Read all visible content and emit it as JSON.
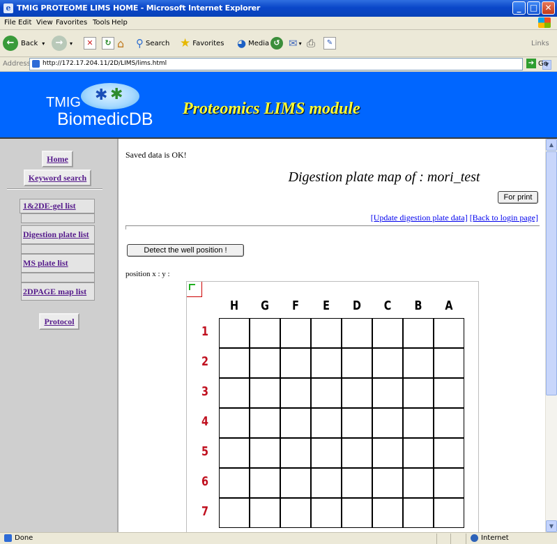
{
  "window": {
    "title": "TMIG PROTEOME LIMS HOME - Microsoft Internet Explorer"
  },
  "menu": [
    "File",
    "Edit",
    "View",
    "Favorites",
    "Tools",
    "Help"
  ],
  "toolbar": {
    "back": "Back",
    "search": "Search",
    "favorites": "Favorites",
    "media": "Media",
    "links": "Links"
  },
  "address": {
    "label": "Address",
    "url": "http://172.17.204.11/2D/LIMS/lims.html",
    "go": "Go"
  },
  "banner": {
    "logo_line1": "TMIG",
    "logo_line2": "BiomedicDB",
    "title": "Proteomics LIMS module"
  },
  "nav": {
    "home": "Home",
    "keyword_search": "Keyword search",
    "gel_list": "1&2DE-gel list",
    "digestion_list": "Digestion plate list",
    "ms_list": "MS plate list",
    "page_map_list": "2DPAGE map list",
    "protocol": "Protocol"
  },
  "main": {
    "saved_message": "Saved data is OK!",
    "heading": "Digestion plate map of : mori_test",
    "for_print": "For print",
    "update_link": "[Update digestion plate data]",
    "back_link": "[Back to login page]",
    "detect_button": "Detect the well position !",
    "position_label": "position x : y :"
  },
  "plate": {
    "columns": [
      "H",
      "G",
      "F",
      "E",
      "D",
      "C",
      "B",
      "A"
    ],
    "rows": [
      "1",
      "2",
      "3",
      "4",
      "5",
      "6",
      "7"
    ]
  },
  "status": {
    "left": "Done",
    "zone": "Internet"
  }
}
